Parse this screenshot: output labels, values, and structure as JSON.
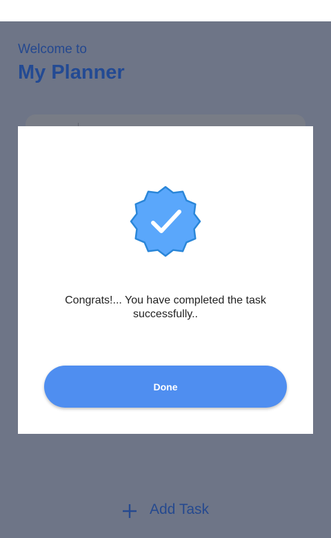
{
  "header": {
    "welcome": "Welcome to",
    "title": "My Planner"
  },
  "footer": {
    "add_task_label": "Add Task",
    "add_icon": "plus-icon"
  },
  "dialog": {
    "icon": "verified-check-badge-icon",
    "message": "Congrats!... You have completed the task successfully..",
    "done_label": "Done"
  },
  "colors": {
    "primary": "#4f8ef0",
    "badge": "#5aa7fb",
    "heading": "#24488f",
    "scrim": "#6e7587"
  }
}
